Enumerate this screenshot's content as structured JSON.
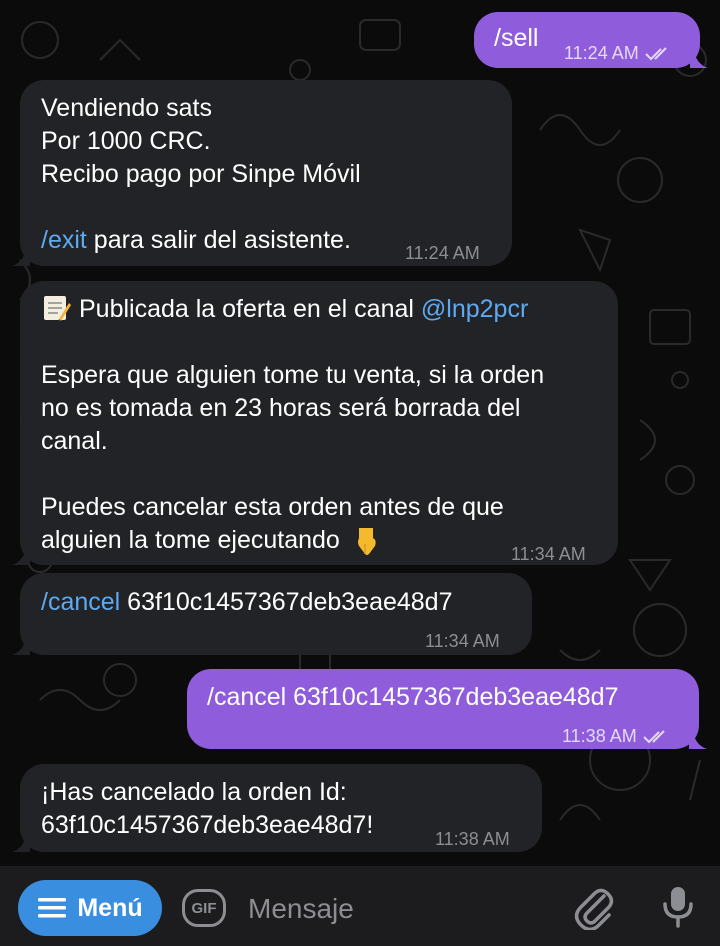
{
  "messages": [
    {
      "id": "m1",
      "dir": "out",
      "lines": [
        "/sell"
      ],
      "time": "11:24 AM"
    },
    {
      "id": "m2",
      "dir": "in",
      "lines": [
        "Vendiendo sats",
        "Por 1000 CRC.",
        "Recibo pago por Sinpe Móvil"
      ],
      "command": "/exit",
      "command_rest": " para salir del asistente.",
      "time": "11:24 AM"
    },
    {
      "id": "m3",
      "dir": "in",
      "line1_prefix": "Publicada la oferta en el canal ",
      "line1_link": "@lnp2pcr",
      "para2": [
        "Espera que alguien tome tu venta, si la orden",
        "no es tomada en 23 horas será borrada del",
        "canal."
      ],
      "para3": [
        "Puedes cancelar esta orden antes de que",
        "alguien la tome ejecutando"
      ],
      "time": "11:34 AM"
    },
    {
      "id": "m4",
      "dir": "in",
      "command": "/cancel",
      "rest": " 63f10c1457367deb3eae48d7",
      "time": "11:34 AM"
    },
    {
      "id": "m5",
      "dir": "out",
      "text": "/cancel 63f10c1457367deb3eae48d7",
      "time": "11:38 AM"
    },
    {
      "id": "m6",
      "dir": "in",
      "lines": [
        "¡Has cancelado la orden Id:",
        "63f10c1457367deb3eae48d7!"
      ],
      "time": "11:38 AM"
    }
  ],
  "composer": {
    "menu_label": "Menú",
    "gif_label": "GIF",
    "placeholder": "Mensaje"
  },
  "icons": {
    "menu": "hamburger-icon",
    "gif": "gif-icon",
    "attach": "paperclip-icon",
    "mic": "microphone-icon",
    "memo": "memo-emoji-icon",
    "point": "point-down-emoji-icon",
    "read": "double-check-icon"
  },
  "colors": {
    "incoming": "#222326",
    "outgoing": "#8f5ddb",
    "link": "#5eaaf0",
    "menu_button": "#3a8ee0"
  }
}
